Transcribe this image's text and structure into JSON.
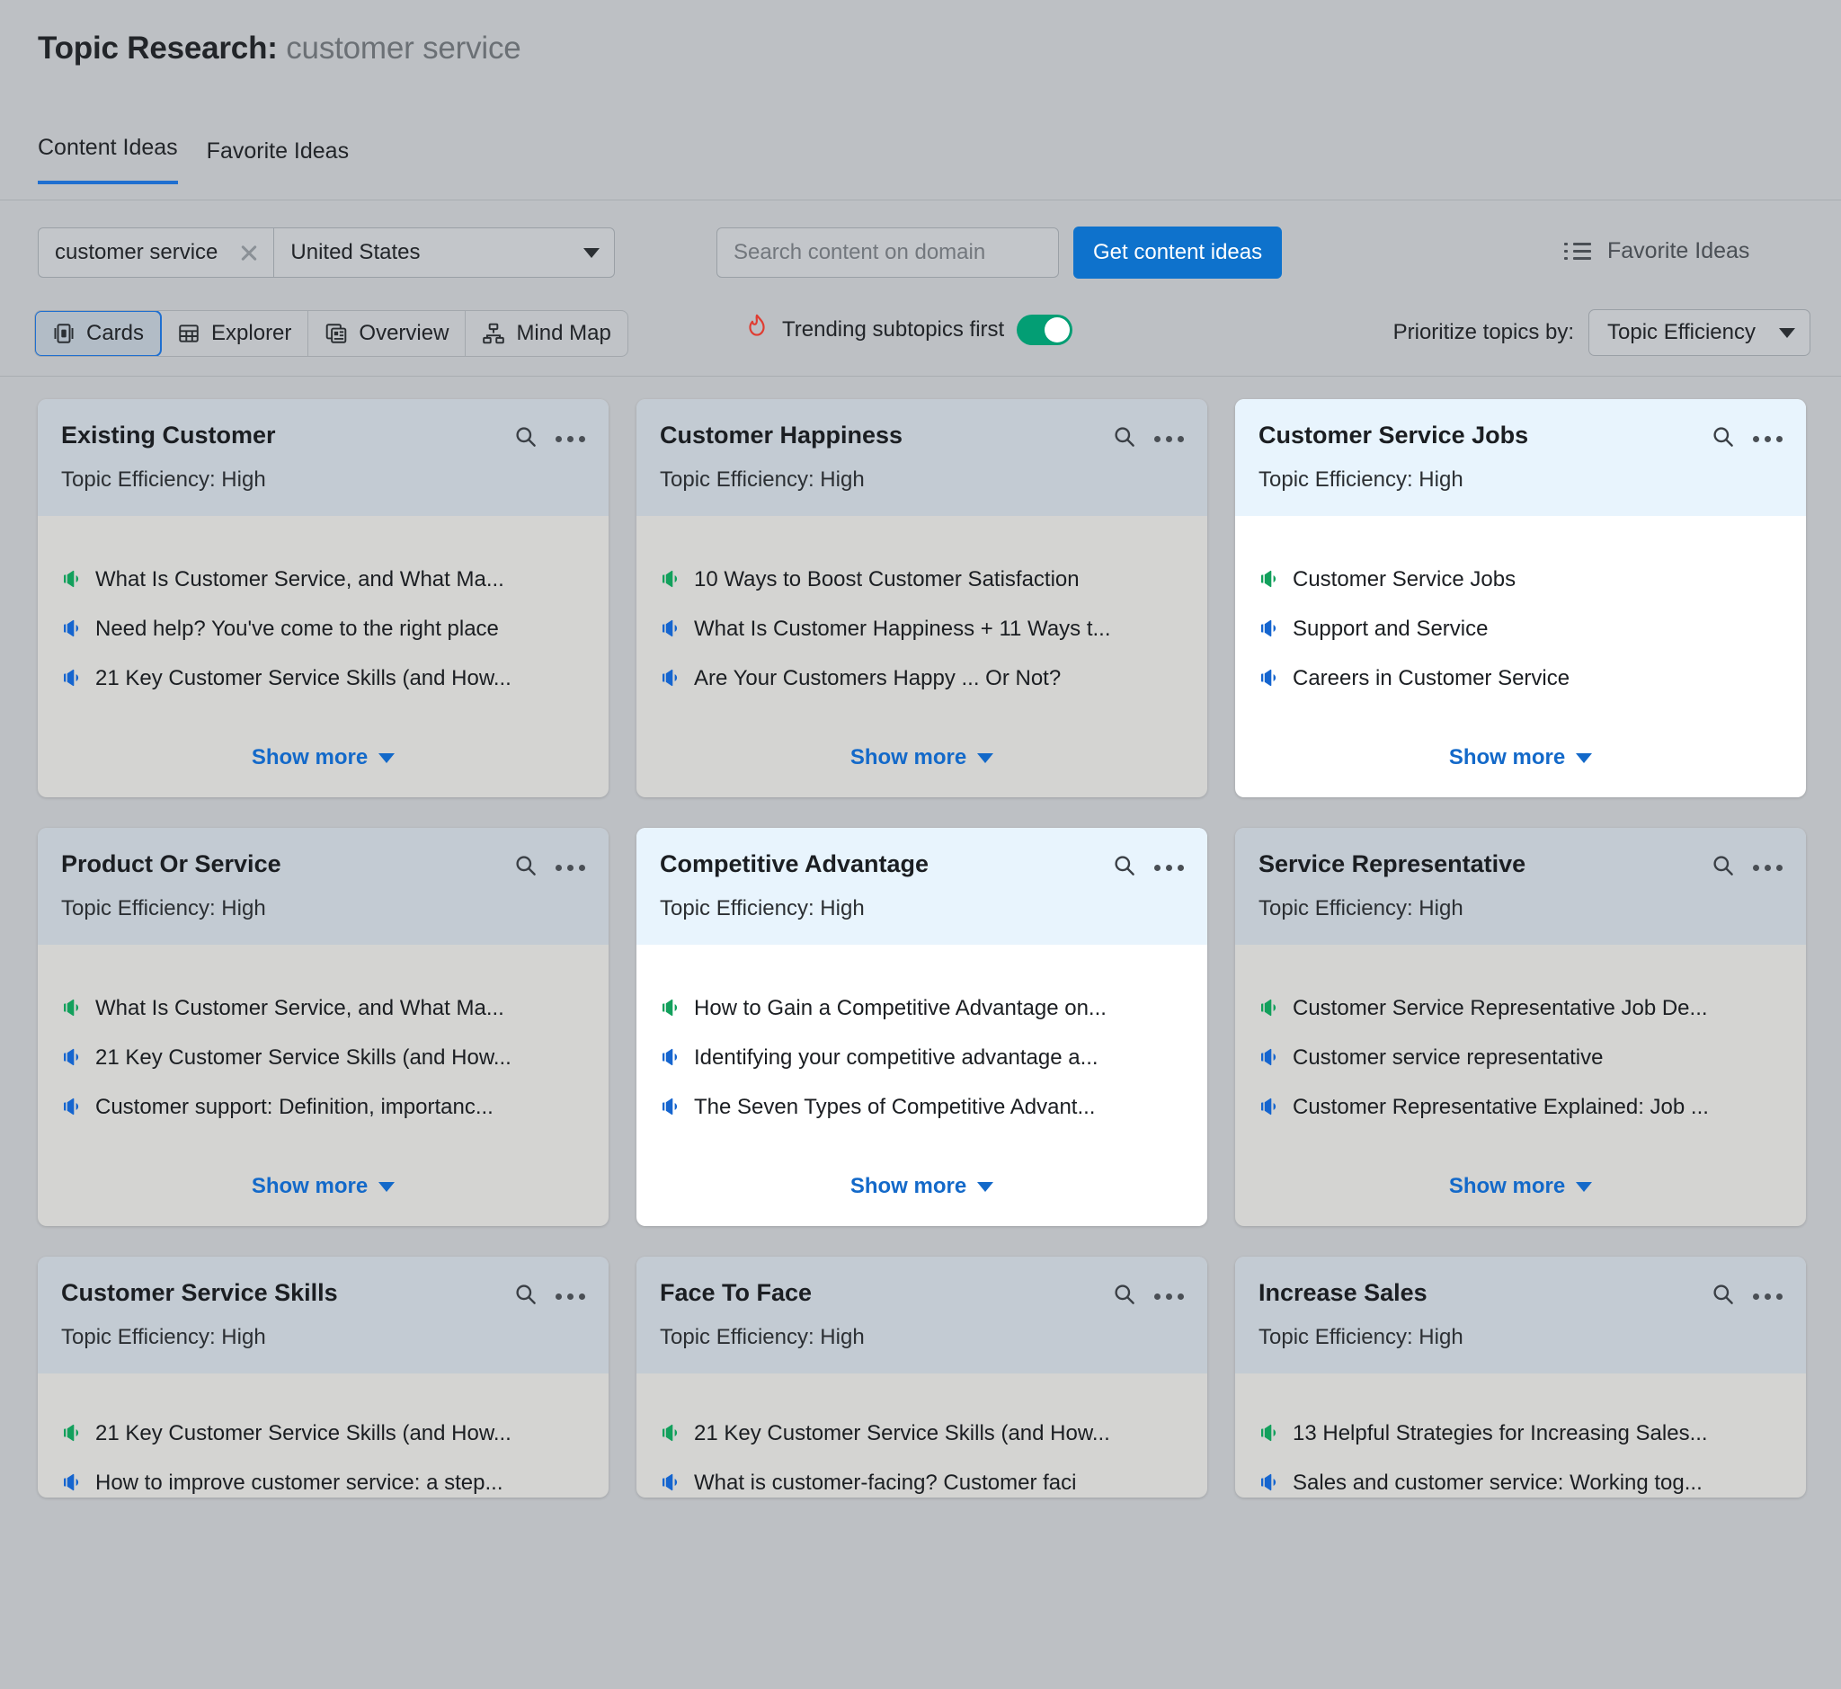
{
  "header": {
    "title_prefix": "Topic Research:",
    "keyword": "customer service"
  },
  "tabs": [
    {
      "label": "Content Ideas",
      "active": true
    },
    {
      "label": "Favorite Ideas",
      "active": false
    }
  ],
  "toolbar": {
    "keyword_value": "customer service",
    "location_value": "United States",
    "domain_placeholder": "Search content on domain",
    "get_ideas_label": "Get content ideas",
    "favorite_ideas_label": "Favorite Ideas",
    "views": [
      {
        "label": "Cards",
        "icon": "cards-icon",
        "active": true
      },
      {
        "label": "Explorer",
        "icon": "table-icon",
        "active": false
      },
      {
        "label": "Overview",
        "icon": "overview-icon",
        "active": false
      },
      {
        "label": "Mind Map",
        "icon": "mindmap-icon",
        "active": false
      }
    ],
    "trending_label": "Trending subtopics first",
    "trending_on": true,
    "prioritize_label": "Prioritize topics by:",
    "prioritize_value": "Topic Efficiency"
  },
  "colors": {
    "accent_blue": "#1369c9",
    "primary_button": "#0e72cc",
    "toggle_green": "#039e74",
    "mega_green": "#12a05c",
    "mega_blue": "#1565cf",
    "card_header": "#c3cbd3",
    "card_body": "#d4d4d2",
    "highlight_header": "#e8f4fd",
    "highlight_body": "#ffffff"
  },
  "cards": [
    {
      "title": "Existing Customer",
      "efficiency": "Topic Efficiency: High",
      "highlight": false,
      "clipped": false,
      "show_more": "Show more",
      "ideas": [
        {
          "text": "What Is Customer Service, and What Ma...",
          "color": "green"
        },
        {
          "text": "Need help? You've come to the right place",
          "color": "blue"
        },
        {
          "text": "21 Key Customer Service Skills (and How...",
          "color": "blue"
        }
      ]
    },
    {
      "title": "Customer Happiness",
      "efficiency": "Topic Efficiency: High",
      "highlight": false,
      "clipped": false,
      "show_more": "Show more",
      "ideas": [
        {
          "text": "10 Ways to Boost Customer Satisfaction",
          "color": "green"
        },
        {
          "text": "What Is Customer Happiness + 11 Ways t...",
          "color": "blue"
        },
        {
          "text": "Are Your Customers Happy ... Or Not?",
          "color": "blue"
        }
      ]
    },
    {
      "title": "Customer Service Jobs",
      "efficiency": "Topic Efficiency: High",
      "highlight": true,
      "clipped": false,
      "show_more": "Show more",
      "ideas": [
        {
          "text": "Customer Service Jobs",
          "color": "green"
        },
        {
          "text": "Support and Service",
          "color": "blue"
        },
        {
          "text": "Careers in Customer Service",
          "color": "blue"
        }
      ]
    },
    {
      "title": "Product Or Service",
      "efficiency": "Topic Efficiency: High",
      "highlight": false,
      "clipped": false,
      "show_more": "Show more",
      "ideas": [
        {
          "text": "What Is Customer Service, and What Ma...",
          "color": "green"
        },
        {
          "text": "21 Key Customer Service Skills (and How...",
          "color": "blue"
        },
        {
          "text": "Customer support: Definition, importanc...",
          "color": "blue"
        }
      ]
    },
    {
      "title": "Competitive Advantage",
      "efficiency": "Topic Efficiency: High",
      "highlight": true,
      "clipped": false,
      "show_more": "Show more",
      "ideas": [
        {
          "text": "How to Gain a Competitive Advantage on...",
          "color": "green"
        },
        {
          "text": "Identifying your competitive advantage a...",
          "color": "blue"
        },
        {
          "text": "The Seven Types of Competitive Advant...",
          "color": "blue"
        }
      ]
    },
    {
      "title": "Service Representative",
      "efficiency": "Topic Efficiency: High",
      "highlight": false,
      "clipped": false,
      "show_more": "Show more",
      "ideas": [
        {
          "text": "Customer Service Representative Job De...",
          "color": "green"
        },
        {
          "text": "Customer service representative",
          "color": "blue"
        },
        {
          "text": "Customer Representative Explained: Job ...",
          "color": "blue"
        }
      ]
    },
    {
      "title": "Customer Service Skills",
      "efficiency": "Topic Efficiency: High",
      "highlight": false,
      "clipped": true,
      "show_more": "",
      "ideas": [
        {
          "text": "21 Key Customer Service Skills (and How...",
          "color": "green"
        },
        {
          "text": "How to improve customer service: a step...",
          "color": "blue"
        }
      ]
    },
    {
      "title": "Face To Face",
      "efficiency": "Topic Efficiency: High",
      "highlight": false,
      "clipped": true,
      "show_more": "",
      "ideas": [
        {
          "text": "21 Key Customer Service Skills (and How...",
          "color": "green"
        },
        {
          "text": "What is customer-facing? Customer faci",
          "color": "blue"
        }
      ]
    },
    {
      "title": "Increase Sales",
      "efficiency": "Topic Efficiency: High",
      "highlight": false,
      "clipped": true,
      "show_more": "",
      "ideas": [
        {
          "text": "13 Helpful Strategies for Increasing Sales...",
          "color": "green"
        },
        {
          "text": "Sales and customer service: Working tog...",
          "color": "blue"
        }
      ]
    }
  ]
}
